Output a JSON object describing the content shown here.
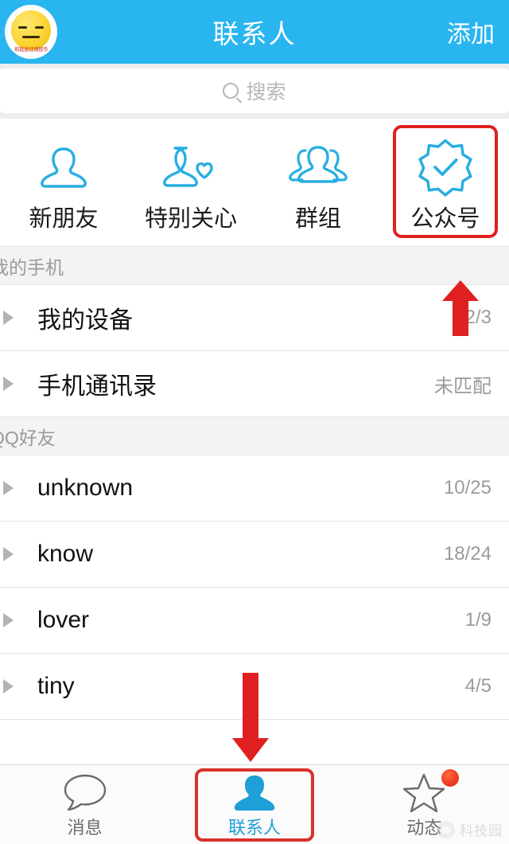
{
  "header": {
    "title": "联系人",
    "action_label": "添加",
    "avatar_tag": "和我说话请按币",
    "background_color": "#29b5ef"
  },
  "search": {
    "placeholder": "搜索",
    "icon": "search-icon"
  },
  "quick_actions": [
    {
      "label": "新朋友",
      "icon": "person-outline-icon",
      "highlighted": false
    },
    {
      "label": "特别关心",
      "icon": "person-heart-outline-icon",
      "highlighted": false
    },
    {
      "label": "群组",
      "icon": "group-people-outline-icon",
      "highlighted": false
    },
    {
      "label": "公众号",
      "icon": "verified-badge-check-icon",
      "highlighted": true
    }
  ],
  "sections": [
    {
      "title": "我的手机",
      "rows": [
        {
          "label": "我的设备",
          "count": "2/3"
        },
        {
          "label": "手机通讯录",
          "count": "未匹配"
        }
      ]
    },
    {
      "title": "QQ好友",
      "rows": [
        {
          "label": "unknown",
          "count": "10/25"
        },
        {
          "label": "know",
          "count": "18/24"
        },
        {
          "label": "lover",
          "count": "1/9"
        },
        {
          "label": "tiny",
          "count": "4/5"
        }
      ]
    }
  ],
  "tabbar": [
    {
      "label": "消息",
      "icon": "chat-bubble-icon",
      "active": false,
      "badge": false,
      "highlighted": false
    },
    {
      "label": "联系人",
      "icon": "person-solid-icon",
      "active": true,
      "badge": false,
      "highlighted": true
    },
    {
      "label": "动态",
      "icon": "star-outline-icon",
      "active": false,
      "badge": true,
      "highlighted": false
    }
  ],
  "annotations": {
    "arrow_up_color": "#e02020",
    "arrow_down_color": "#e02020",
    "highlight_box_color": "#d8302a"
  },
  "watermark": {
    "text": "科技园"
  }
}
